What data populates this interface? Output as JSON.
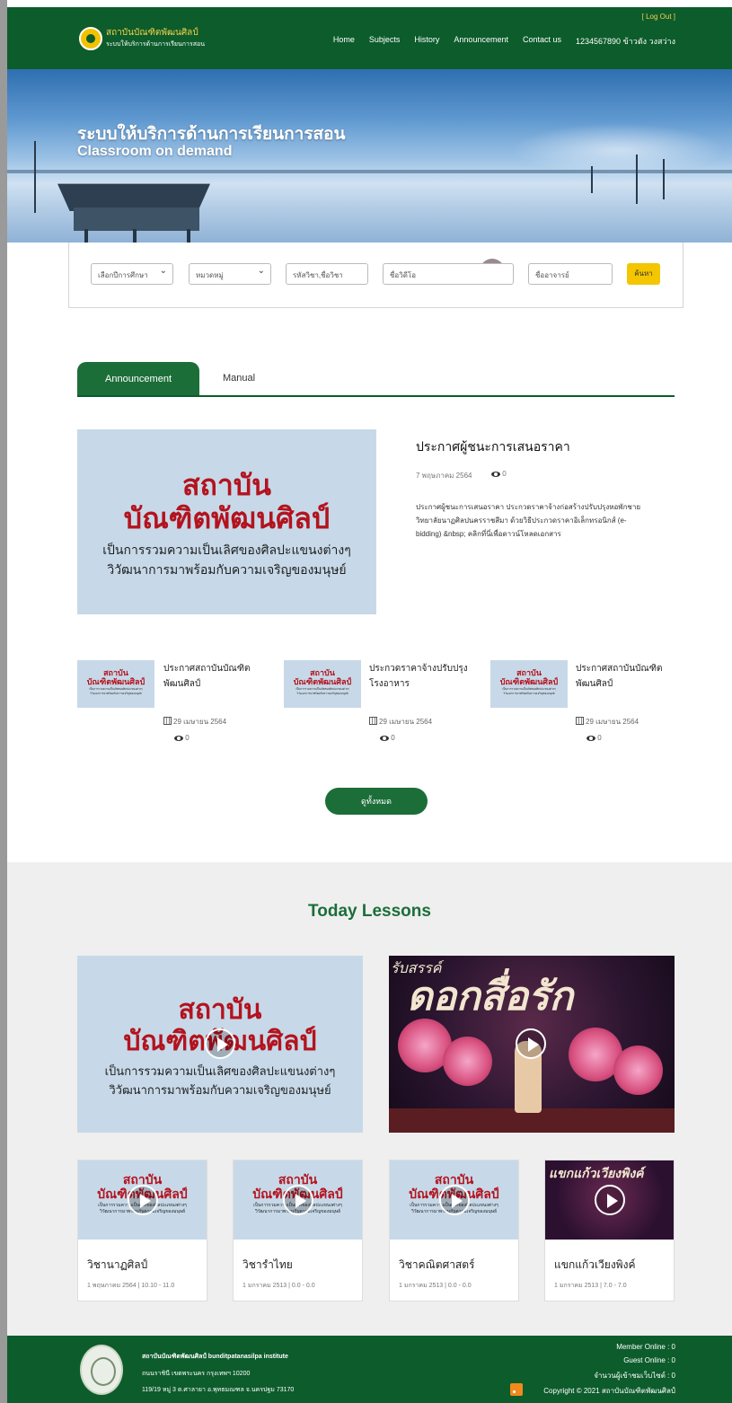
{
  "header": {
    "logo_title": "สถาบันบัณฑิตพัฒนศิลป์",
    "logo_subtitle": "ระบบให้บริการด้านการเรียนการสอน",
    "logout": "[ Log Out ]",
    "nav": [
      "Home",
      "Subjects",
      "History",
      "Announcement",
      "Contact us",
      "1234567890 ข้าวตัง วงสว่าง"
    ]
  },
  "hero": {
    "title": "ระบบให้บริการด้านการเรียนการสอน",
    "subtitle": "Classroom on demand"
  },
  "search": {
    "academic_year": "เลือกปีการศึกษา",
    "category": "หมวดหมู่",
    "course_code": "รหัสวิชา,ชื่อวิชา",
    "video_name": "ชื่อวิดีโอ",
    "teacher": "ชื่ออาจารย์",
    "button": "ค้นหา"
  },
  "tabs": [
    "Announcement",
    "Manual"
  ],
  "placeholder_logo": {
    "line1": "สถาบัน",
    "line2": "บัณฑิตพัฒนศิลป์",
    "line3": "เป็นการรวมความเป็นเลิศของศิลปะแขนงต่างๆ",
    "line4": "วิวัฒนาการมาพร้อมกับความเจริญของมนุษย์"
  },
  "featured": {
    "title": "ประกาศผู้ชนะการเสนอราคา",
    "date": "7 พฤษภาคม 2564",
    "views": "0",
    "description": "ประกาศผู้ชนะการเสนอราคา ประกวดราคาจ้างก่อสร้างปรับปรุงหอพักชาย วิทยาลัยนาฏศิลปนครราชสีมา ด้วยวิธีประกวดราคาอิเล็กทรอนิกส์ (e-bidding) &nbsp; คลิกที่นี่เพื่อดาวน์โหลดเอกสาร"
  },
  "news": [
    {
      "title": "ประกาศสถาบันบัณฑิตพัฒนศิลป์",
      "date": "29 เมษายน 2564",
      "views": "0"
    },
    {
      "title": "ประกวดราคาจ้างปรับปรุงโรงอาหาร",
      "date": "29 เมษายน 2564",
      "views": "0"
    },
    {
      "title": "ประกาศสถาบันบัณฑิตพัฒนศิลป์",
      "date": "29 เมษายน 2564",
      "views": "0"
    }
  ],
  "see_all": "ดูทั้งหมด",
  "lessons": {
    "title": "Today Lessons",
    "video_text_small": "รับสรรค์",
    "video_text_large": "ดอกสื่อรัก",
    "cards": [
      {
        "title": "วิชานาฏศิลป์",
        "time": "1 พฤษภาคม 2564  |  10.10 - 11.0"
      },
      {
        "title": "วิชารำไทย",
        "time": "1 มกราคม 2513  |  0.0 - 0.0"
      },
      {
        "title": "วิชาคณิตศาสตร์",
        "time": "1 มกราคม 2513  |  0.0 - 0.0"
      },
      {
        "title": "แขกแก้วเวียงพิงค์",
        "time": "1 มกราคม 2513  |  7.0 - 7.0"
      }
    ],
    "card4_thumb_text": "แขกแก้วเวียงพิงค์"
  },
  "footer": {
    "name": "สถาบันบัณฑิตพัฒนศิลป์ bunditpatanasilpa institute",
    "address1": "ถนนราชินี เขตพระนคร กรุงเทพฯ 10200",
    "address2": "119/19 หมู่ 3 ต.ศาลายา อ.พุทธมณฑล จ.นครปฐม 73170",
    "member_online": "Member Online : 0",
    "guest_online": "Guest Online : 0",
    "visitors": "จำนวนผู้เข้าชมเว็บไซต์ : 0",
    "copyright": "Copyright © 2021 สถาบันบัณฑิตพัฒนศิลป์"
  }
}
